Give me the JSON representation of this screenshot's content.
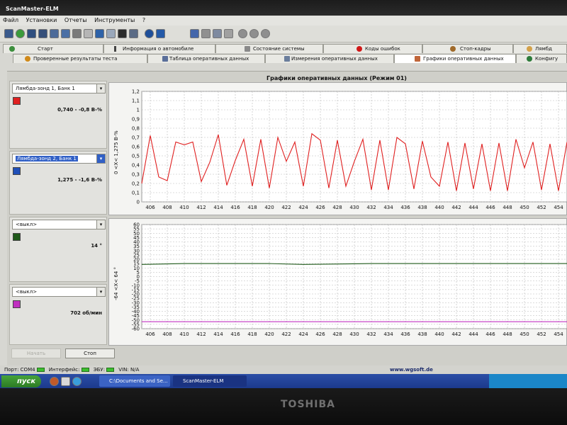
{
  "window": {
    "title": "ScanMaster-ELM"
  },
  "menu": {
    "items": [
      "Файл",
      "Установки",
      "Отчеты",
      "Инструменты",
      "?"
    ]
  },
  "tabs_row1": [
    {
      "label": "Старт",
      "icon": "start-icon"
    },
    {
      "label": "Информация о автомобиле",
      "icon": "info-icon"
    },
    {
      "label": "Состояние системы",
      "icon": "system-status-icon"
    },
    {
      "label": "Коды ошибок",
      "icon": "error-codes-icon"
    },
    {
      "label": "Стоп-кадры",
      "icon": "freeze-frame-icon"
    },
    {
      "label": "Лямбд",
      "icon": "lambda-icon"
    }
  ],
  "tabs_row2": [
    {
      "label": "Проверенные результаты теста",
      "icon": "test-results-icon"
    },
    {
      "label": "Таблица оперативных данных",
      "icon": "table-icon"
    },
    {
      "label": "Измерения оперативных данных",
      "icon": "measure-icon"
    },
    {
      "label": "Графики оперативных данных",
      "icon": "graph-icon",
      "active": true
    },
    {
      "label": "Конфигу",
      "icon": "config-icon"
    }
  ],
  "panel": {
    "title": "Графики оперативных данных (Режим 01)"
  },
  "channels": [
    {
      "select": "Лямбда-зонд 1, Банк 1",
      "color": "#e02020",
      "value": "0,740 - -0,8 В-%"
    },
    {
      "select": "Лямбда-зонд 2, Банк 1",
      "color": "#1f4fb8",
      "value": "1,275 - -1,6 В-%"
    },
    {
      "select": "<выкл>",
      "color": "#1f5a1a",
      "value": "14 °"
    },
    {
      "select": "<выкл>",
      "color": "#c030c0",
      "value": "702 об/мин"
    }
  ],
  "buttons": {
    "start": "Начать",
    "stop": "Стоп"
  },
  "status": {
    "port_label": "Порт:",
    "port": "COM4",
    "interface_label": "Интерфейс:",
    "ecu_label": "ЭБУ:",
    "vin_label": "VIN: N/A",
    "website": "www.wgsoft.de"
  },
  "taskbar": {
    "start_label": "пуск",
    "task1": "C:\\Documents and Se...",
    "task2": "ScanMaster-ELM"
  },
  "bezel": {
    "brand": "TOSHIBA"
  },
  "chart_data": [
    {
      "type": "line",
      "ylabel": "0  <X<  1,275  В-%",
      "xlim": [
        405,
        455
      ],
      "ylim": [
        0,
        1.2
      ],
      "grid": true,
      "yticks": [
        0,
        0.1,
        0.2,
        0.3,
        0.4,
        0.5,
        0.6,
        0.7,
        0.8,
        0.9,
        1,
        1.1,
        1.2
      ],
      "yticklabels": [
        "0",
        "0,1",
        "0,2",
        "0,3",
        "0,4",
        "0,5",
        "0,6",
        "0,7",
        "0,8",
        "0,9",
        "1",
        "1,1",
        "1,2"
      ],
      "xticks": [
        406,
        408,
        410,
        412,
        414,
        416,
        418,
        420,
        422,
        424,
        426,
        428,
        430,
        432,
        434,
        436,
        438,
        440,
        442,
        444,
        446,
        448,
        450,
        452,
        454
      ],
      "series": [
        {
          "color": "#e02020",
          "x": [
            405,
            406,
            407,
            408,
            409,
            410,
            411,
            412,
            413,
            414,
            415,
            416,
            417,
            418,
            419,
            420,
            421,
            422,
            423,
            424,
            425,
            426,
            427,
            428,
            429,
            430,
            431,
            432,
            433,
            434,
            435,
            436,
            437,
            438,
            439,
            440,
            441,
            442,
            443,
            444,
            445,
            446,
            447,
            448,
            449,
            450,
            451,
            452,
            453,
            454,
            455
          ],
          "y": [
            0.2,
            0.72,
            0.27,
            0.23,
            0.65,
            0.62,
            0.65,
            0.22,
            0.43,
            0.73,
            0.18,
            0.45,
            0.68,
            0.17,
            0.68,
            0.15,
            0.7,
            0.44,
            0.65,
            0.17,
            0.74,
            0.67,
            0.15,
            0.67,
            0.17,
            0.44,
            0.68,
            0.13,
            0.67,
            0.13,
            0.7,
            0.63,
            0.14,
            0.66,
            0.27,
            0.17,
            0.65,
            0.12,
            0.64,
            0.14,
            0.63,
            0.12,
            0.64,
            0.12,
            0.68,
            0.37,
            0.65,
            0.13,
            0.63,
            0.12,
            0.65
          ]
        }
      ]
    },
    {
      "type": "line",
      "ylabel": "-64  <X<  64  °",
      "xlim": [
        405,
        455
      ],
      "ylim": [
        -60,
        60
      ],
      "grid": true,
      "yticks": [
        -60,
        -55,
        -50,
        -45,
        -40,
        -35,
        -30,
        -25,
        -20,
        -15,
        -10,
        -5,
        0,
        5,
        10,
        15,
        20,
        25,
        30,
        35,
        40,
        45,
        50,
        55,
        60
      ],
      "xticks": [
        406,
        408,
        410,
        412,
        414,
        416,
        418,
        420,
        422,
        424,
        426,
        428,
        430,
        432,
        434,
        436,
        438,
        440,
        442,
        444,
        446,
        448,
        450,
        452,
        454
      ],
      "series": [
        {
          "color": "#1f5a1a",
          "x": [
            405,
            410,
            420,
            424,
            432,
            440,
            455
          ],
          "y": [
            14,
            15,
            15,
            14,
            15,
            15,
            15
          ]
        },
        {
          "color": "#c030c0",
          "x": [
            405,
            455
          ],
          "y": [
            -52,
            -52
          ]
        }
      ]
    }
  ]
}
